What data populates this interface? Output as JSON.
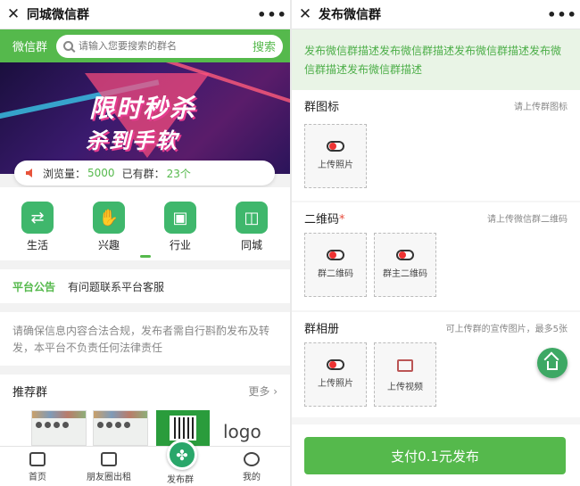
{
  "left": {
    "topbar": {
      "title": "同城微信群"
    },
    "greenbar": {
      "brand": "微信群",
      "search_placeholder": "请输入您要搜索的群名",
      "search_button": "搜索"
    },
    "banner": {
      "line1": "限时秒杀",
      "line2": "杀到手软"
    },
    "stats": {
      "views_label": "浏览量：",
      "views": "5000",
      "groups_label": "已有群：",
      "groups": "23个"
    },
    "categories": [
      {
        "label": "生活",
        "icon": "exchange-icon"
      },
      {
        "label": "兴趣",
        "icon": "handshake-icon"
      },
      {
        "label": "行业",
        "icon": "taxi-icon"
      },
      {
        "label": "同城",
        "icon": "bag-icon"
      }
    ],
    "notice": {
      "label": "平台公告",
      "text": "有问题联系平台客服"
    },
    "disclaimer": "请确保信息内容合法合规，发布者需自行斟酌发布及转发，本平台不负责任何法律责任",
    "recommend": {
      "title": "推荐群",
      "more": "更多",
      "logo": "logo"
    },
    "tabs": [
      {
        "label": "首页",
        "icon": "home-icon"
      },
      {
        "label": "朋友圈出租",
        "icon": "clipboard-icon"
      },
      {
        "label": "发布群",
        "icon": "fan-icon"
      },
      {
        "label": "我的",
        "icon": "user-icon"
      }
    ]
  },
  "right": {
    "topbar": {
      "title": "发布微信群"
    },
    "description": "发布微信群描述发布微信群描述发布微信群描述发布微信群描述发布微信群描述",
    "group_icon": {
      "title": "群图标",
      "hint": "请上传群图标",
      "upload_label": "上传照片"
    },
    "qrcode": {
      "title": "二维码",
      "required_mark": "*",
      "hint": "请上传微信群二维码",
      "group_qr_label": "群二维码",
      "owner_qr_label": "群主二维码"
    },
    "album": {
      "title": "群相册",
      "hint": "可上传群的宣传图片，最多5张",
      "photo_label": "上传照片",
      "video_label": "上传视频"
    },
    "pay_button": "支付0.1元发布"
  },
  "colors": {
    "brand_green": "#55b94c",
    "required_red": "#e74c3c"
  }
}
